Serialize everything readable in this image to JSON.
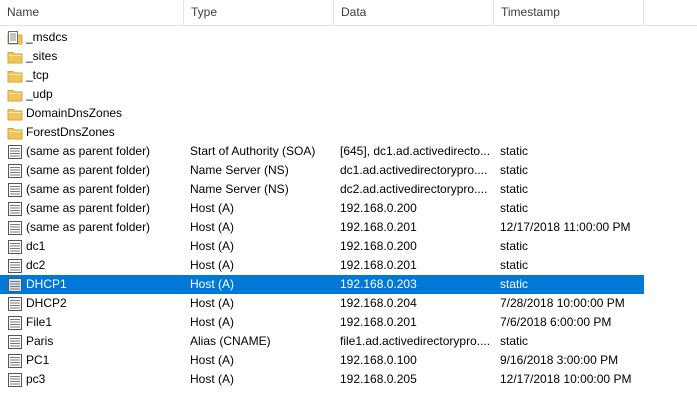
{
  "columns": {
    "name": "Name",
    "type": "Type",
    "data": "Data",
    "timestamp": "Timestamp"
  },
  "rows": [
    {
      "icon": "zone-icon",
      "name": "_msdcs",
      "type": "",
      "data": "",
      "timestamp": ""
    },
    {
      "icon": "folder-icon",
      "name": "_sites",
      "type": "",
      "data": "",
      "timestamp": ""
    },
    {
      "icon": "folder-icon",
      "name": "_tcp",
      "type": "",
      "data": "",
      "timestamp": ""
    },
    {
      "icon": "folder-icon",
      "name": "_udp",
      "type": "",
      "data": "",
      "timestamp": ""
    },
    {
      "icon": "folder-icon",
      "name": "DomainDnsZones",
      "type": "",
      "data": "",
      "timestamp": ""
    },
    {
      "icon": "folder-icon",
      "name": "ForestDnsZones",
      "type": "",
      "data": "",
      "timestamp": ""
    },
    {
      "icon": "record-icon",
      "name": "(same as parent folder)",
      "type": "Start of Authority (SOA)",
      "data": "[645], dc1.ad.activedirecto...",
      "timestamp": "static"
    },
    {
      "icon": "record-icon",
      "name": "(same as parent folder)",
      "type": "Name Server (NS)",
      "data": "dc1.ad.activedirectorypro....",
      "timestamp": "static"
    },
    {
      "icon": "record-icon",
      "name": "(same as parent folder)",
      "type": "Name Server (NS)",
      "data": "dc2.ad.activedirectorypro....",
      "timestamp": "static"
    },
    {
      "icon": "record-icon",
      "name": "(same as parent folder)",
      "type": "Host (A)",
      "data": "192.168.0.200",
      "timestamp": "static"
    },
    {
      "icon": "record-icon",
      "name": "(same as parent folder)",
      "type": "Host (A)",
      "data": "192.168.0.201",
      "timestamp": "12/17/2018 11:00:00 PM"
    },
    {
      "icon": "record-icon",
      "name": "dc1",
      "type": "Host (A)",
      "data": "192.168.0.200",
      "timestamp": "static"
    },
    {
      "icon": "record-icon",
      "name": "dc2",
      "type": "Host (A)",
      "data": "192.168.0.201",
      "timestamp": "static"
    },
    {
      "icon": "record-icon",
      "name": "DHCP1",
      "type": "Host (A)",
      "data": "192.168.0.203",
      "timestamp": "static",
      "selected": true
    },
    {
      "icon": "record-icon",
      "name": "DHCP2",
      "type": "Host (A)",
      "data": "192.168.0.204",
      "timestamp": "7/28/2018 10:00:00 PM"
    },
    {
      "icon": "record-icon",
      "name": "File1",
      "type": "Host (A)",
      "data": "192.168.0.201",
      "timestamp": "7/6/2018 6:00:00 PM"
    },
    {
      "icon": "record-icon",
      "name": "Paris",
      "type": "Alias (CNAME)",
      "data": "file1.ad.activedirectorypro....",
      "timestamp": "static"
    },
    {
      "icon": "record-icon",
      "name": "PC1",
      "type": "Host (A)",
      "data": "192.168.0.100",
      "timestamp": "9/16/2018 3:00:00 PM"
    },
    {
      "icon": "record-icon",
      "name": "pc3",
      "type": "Host (A)",
      "data": "192.168.0.205",
      "timestamp": "12/17/2018 10:00:00 PM"
    }
  ],
  "colors": {
    "selection": "#0078d7",
    "folder": "#f2c55c",
    "header_divider": "#e5e5e5"
  }
}
